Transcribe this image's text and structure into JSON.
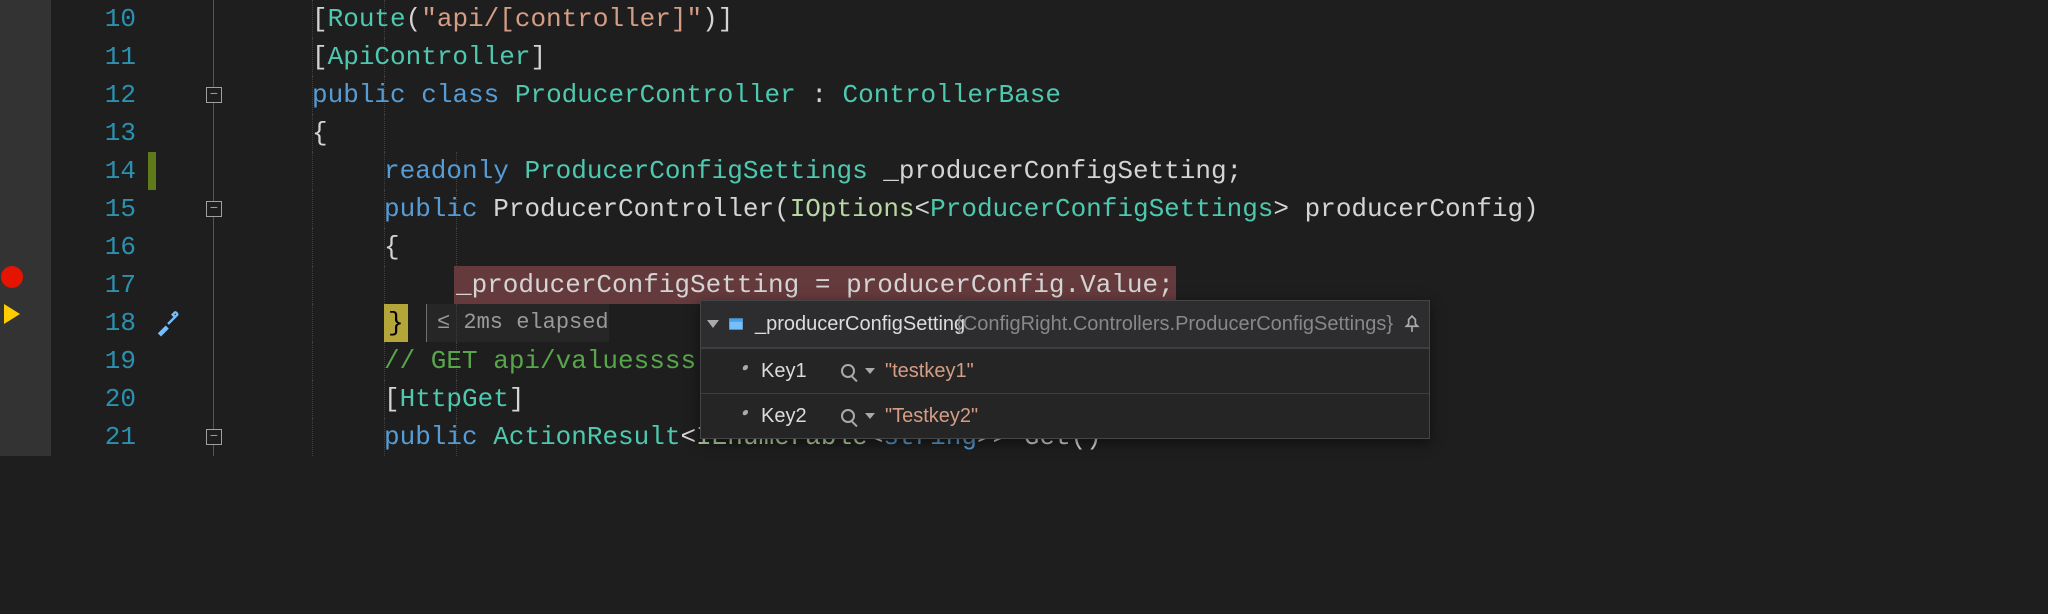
{
  "lines": {
    "10": {
      "indent": 2,
      "attr_pre": "[",
      "type": "Route",
      "attr_open": "(",
      "str": "\"api/[controller]\"",
      "attr_close": ")]"
    },
    "11": {
      "indent": 2,
      "attr_pre": "[",
      "type": "ApiController",
      "attr_close": "]"
    },
    "12": {
      "indent": 2,
      "kw1": "public",
      "kw2": "class",
      "type1": "ProducerController",
      "colon": " : ",
      "type2": "ControllerBase"
    },
    "13": {
      "indent": 2,
      "brace": "{"
    },
    "14": {
      "indent": 3,
      "kw1": "readonly",
      "type1": "ProducerConfigSettings",
      "id": " _producerConfigSetting;"
    },
    "15": {
      "indent": 3,
      "kw1": "public",
      "ctor": "ProducerController",
      "open": "(",
      "iopt": "IOptions",
      "lt": "<",
      "gtype": "ProducerConfigSettings",
      "gt": ">",
      "param": " producerConfig)"
    },
    "16": {
      "indent": 3,
      "brace": "{"
    },
    "17": {
      "indent": 4,
      "stmt": "_producerConfigSetting = producerConfig.Value;"
    },
    "18": {
      "indent": 3,
      "brace": "}",
      "perf": "≤ 2ms elapsed"
    },
    "19": {
      "indent": 3,
      "comment": "// GET api/valuessss"
    },
    "20": {
      "indent": 3,
      "attr_pre": "[",
      "type": "HttpGet",
      "attr_close": "]"
    },
    "21": {
      "indent": 3,
      "kw1": "public",
      "type1": "ActionResult",
      "lt": "<",
      "iface1": "IEnumerable",
      "lt2": "<",
      "kw2": "string",
      "gt": ">> ",
      "method": "Get()"
    }
  },
  "tooltip": {
    "varName": "_producerConfigSetting",
    "value": "{ConfigRight.Controllers.ProducerConfigSettings}",
    "rows": [
      {
        "key": "Key1",
        "val": "\"testkey1\""
      },
      {
        "key": "Key2",
        "val": "\"Testkey2\""
      }
    ]
  }
}
